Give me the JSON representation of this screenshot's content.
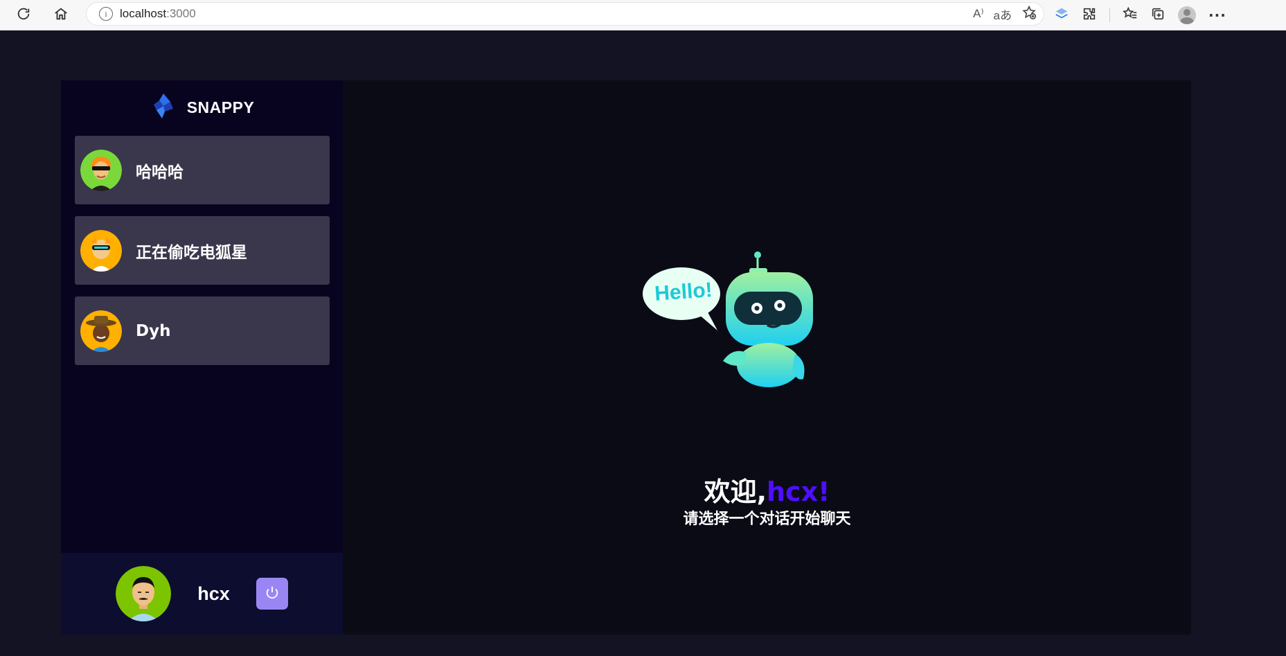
{
  "browser": {
    "url_host": "localhost",
    "url_port": ":3000",
    "read_aloud_icon": "A⁾",
    "translate_label": "aあ"
  },
  "app": {
    "brand_name": "SNAPPY",
    "contacts": [
      {
        "name": "哈哈哈",
        "avatar_bg": "#7bd83a"
      },
      {
        "name": "正在偷吃电狐星",
        "avatar_bg": "#ffb000"
      },
      {
        "name": "Dyh",
        "avatar_bg": "#ffb000"
      }
    ],
    "current_user": {
      "name": "hcx",
      "avatar_bg": "#7cc400"
    },
    "welcome": {
      "greeting": "欢迎,",
      "username": "hcx!",
      "subtitle": "请选择一个对话开始聊天",
      "bubble_text": "Hello!"
    },
    "colors": {
      "accent": "#4e0eff",
      "logout_bg": "#9a86f3",
      "contact_bg": "#ffffff34",
      "sidebar_bg": "#080420"
    }
  }
}
